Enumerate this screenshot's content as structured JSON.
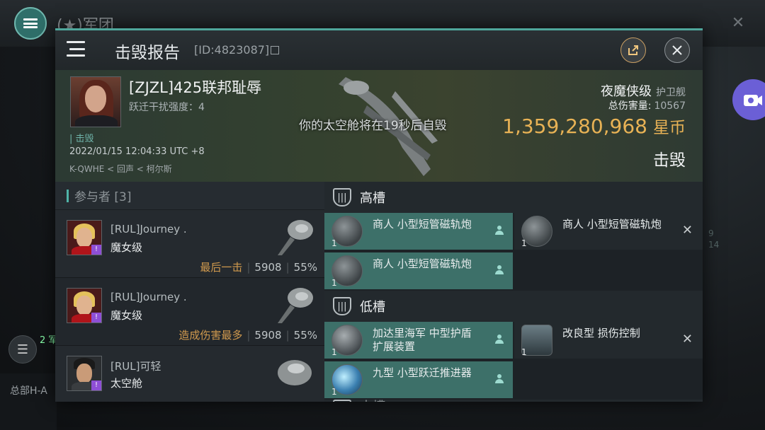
{
  "background": {
    "title": "(★)军团",
    "hq_text": "总部H-A",
    "side_badge": "2",
    "side_label": "军",
    "right_numbers": [
      "9",
      "14"
    ]
  },
  "modal": {
    "title": "击毁报告",
    "id_text": "[ID:4823087]",
    "accent": "#4fa79c"
  },
  "victim": {
    "name": "[ZJZL]425联邦耻辱",
    "warp_disrupt": "跃迁干扰强度：4",
    "tag": "击毁",
    "timestamp": "2022/01/15 12:04:33 UTC +8",
    "location": "K-QWHE < 回声 < 柯尔斯",
    "notice": "你的太空舱将在19秒后自毁",
    "ship_name": "夜魔侠级",
    "ship_class": "护卫舰",
    "damage_label": "总伤害量:",
    "damage_value": "10567",
    "isk_value": "1,359,280,968",
    "isk_unit": "星币",
    "result": "击毁"
  },
  "participants": {
    "header": "参与者 [3]",
    "rows": [
      {
        "name": "[RUL]Journey .",
        "ship": "魔女级",
        "tag": "最后一击",
        "damage": "5908",
        "percent": "55%"
      },
      {
        "name": "[RUL]Journey .",
        "ship": "魔女级",
        "tag": "造成伤害最多",
        "damage": "5908",
        "percent": "55%"
      },
      {
        "name": "[RUL]可轻",
        "ship": "太空舱",
        "tag": "",
        "damage": "",
        "percent": ""
      }
    ]
  },
  "fitting": {
    "high_label": "高槽",
    "high_modules": [
      {
        "name": "商人 小型短管磁轨炮",
        "qty": "1",
        "state": "online"
      },
      {
        "name": "商人 小型短管磁轨炮",
        "qty": "1",
        "state": "destroyed"
      },
      {
        "name": "商人 小型短管磁轨炮",
        "qty": "1",
        "state": "online"
      }
    ],
    "low_label": "低槽",
    "low_modules": [
      {
        "name": "加达里海军 中型护盾扩展装置",
        "qty": "1",
        "state": "online"
      },
      {
        "name": "改良型 损伤控制",
        "qty": "1",
        "state": "destroyed"
      },
      {
        "name": "九型 小型跃迁推进器",
        "qty": "1",
        "state": "online"
      }
    ],
    "next_label": "中槽"
  },
  "icons": {
    "menu": "menu-icon",
    "share": "share-icon",
    "close": "close-icon",
    "camera": "camera-icon",
    "pilot": "pilot-icon",
    "destroyed": "x-icon"
  },
  "colors": {
    "isk_gold": "#e8b255",
    "tag_orange": "#d19a4e",
    "module_online": "#3d7069"
  }
}
